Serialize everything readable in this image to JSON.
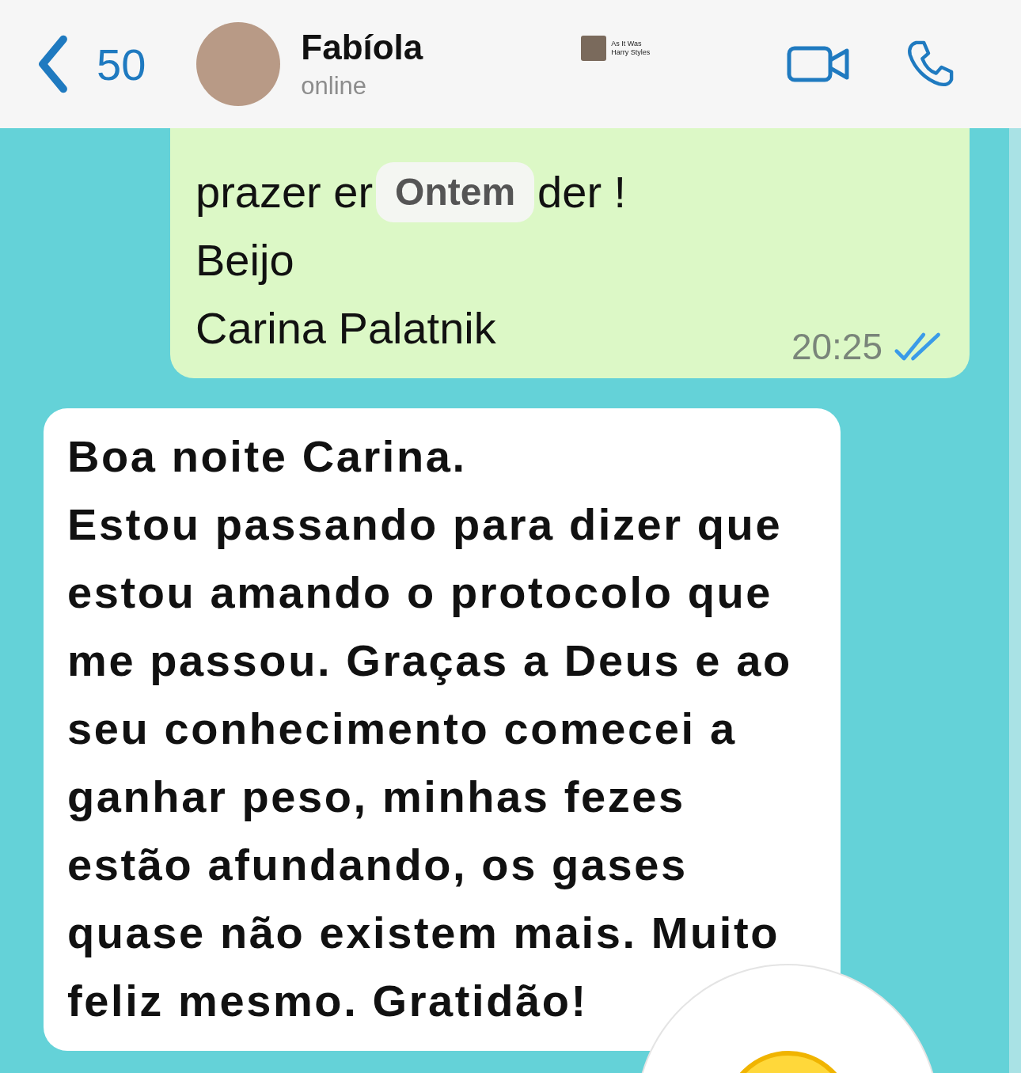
{
  "header": {
    "back_count": "50",
    "contact_name": "Fabíola",
    "status": "online",
    "now_playing": {
      "title": "As It Was",
      "artist": "Harry Styles"
    }
  },
  "messages": [
    {
      "kind": "outgoing",
      "chip_line": {
        "before": "prazer er",
        "chip": "Ontem",
        "after": "der !"
      },
      "lines": [
        "Beijo",
        "Carina Palatnik"
      ],
      "time": "20:25",
      "read": true
    },
    {
      "kind": "incoming",
      "text": "Boa noite Carina.\nEstou passando para dizer que estou amando o protocolo que me passou. Graças a Deus e ao seu conhecimento comecei a ganhar peso, minhas fezes estão afundando, os gases quase não existem mais. Muito feliz mesmo. Gratidão!"
    }
  ]
}
